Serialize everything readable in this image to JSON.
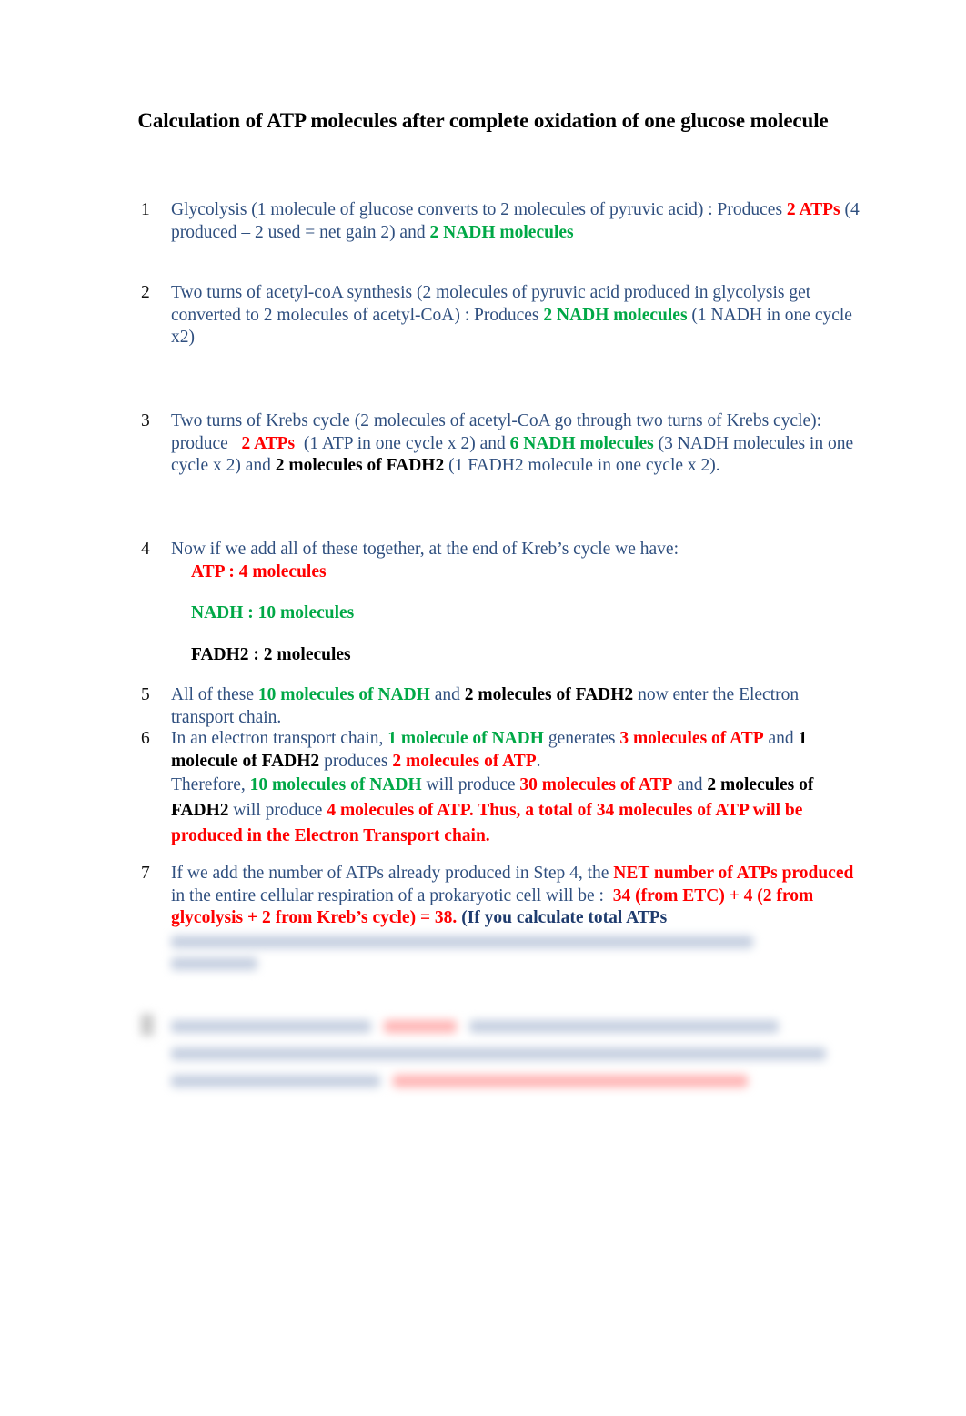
{
  "title": "Calculation of ATP molecules after complete oxidation of one glucose molecule",
  "colors": {
    "atp_red": "#ff0000",
    "nadh_green": "#00a846",
    "text_navy": "#2f4f7f",
    "fadh2_black": "#000000"
  },
  "steps": [
    {
      "number": "1",
      "t1": "Glycolysis (1 molecule of glucose converts to 2 molecules of pyruvic acid) : Produces ",
      "r1": "2 ATPs",
      "t2": " (4 produced – 2 used = net gain 2) and  ",
      "g1": "2 NADH molecules"
    },
    {
      "number": "2",
      "t1": "Two turns of acetyl-coA synthesis (2 molecules of pyruvic acid produced in glycolysis get converted to 2 molecules of acetyl-CoA) : Produces ",
      "g1": "2 NADH molecules",
      "t2": " (1 NADH in one cycle x2)"
    },
    {
      "number": "3",
      "t1": "Two turns of Krebs cycle (2 molecules of acetyl-CoA go through two turns of Krebs cycle): produce   ",
      "r1": "2 ATPs",
      "t2": "  (1 ATP in one cycle x 2) and ",
      "g1": "6 NADH molecules",
      "t3": " (3 NADH molecules in one cycle x 2) and ",
      "b1": "2 molecules of FADH2",
      "t4": " (1 FADH2 molecule in one cycle x 2)."
    },
    {
      "number": "4",
      "t1": "Now if we add all of these together, at the end of Kreb’s cycle we have:",
      "sum_atp": "ATP : 4 molecules",
      "sum_nadh": "NADH : 10 molecules",
      "sum_fadh2": "FADH2 : 2 molecules"
    },
    {
      "number": "5",
      "t1": "All of these ",
      "g1": "10 molecules of NADH",
      "t2": " and ",
      "b1": "2 molecules of FADH2",
      "t3": " now enter the Electron transport chain."
    },
    {
      "number": "6",
      "t1": "In an electron transport chain, ",
      "g1": "1 molecule of NADH",
      "t2": " generates ",
      "r1": "3 molecules of ATP",
      "t3": " and ",
      "b1": "1 molecule of FADH2",
      "t4": " produces ",
      "r2": "2 molecules of ATP",
      "t5": ".",
      "t6": "Therefore, ",
      "g2": "10 molecules of NADH",
      "t7": " will produce ",
      "r3": "30 molecules of ATP",
      "t8": " and ",
      "b2": "2 molecules of FADH2",
      "t9": " will produce ",
      "r4": "4 molecules of ATP. Thus, a total of 34 molecules of ATP will be produced in the Electron Transport chain."
    },
    {
      "number": "7",
      "t1": "If we add the number of ATPs already produced in Step 4, the ",
      "r1": "NET number of ATPs produced",
      "t2": " in the entire cellular respiration of a prokaryotic cell will be :  ",
      "r2": "34 (from ETC) + 4 (2 from glycolysis + 2 from Kreb’s cycle) = 38.",
      "n1": " (If you calculate total ATPs"
    }
  ]
}
